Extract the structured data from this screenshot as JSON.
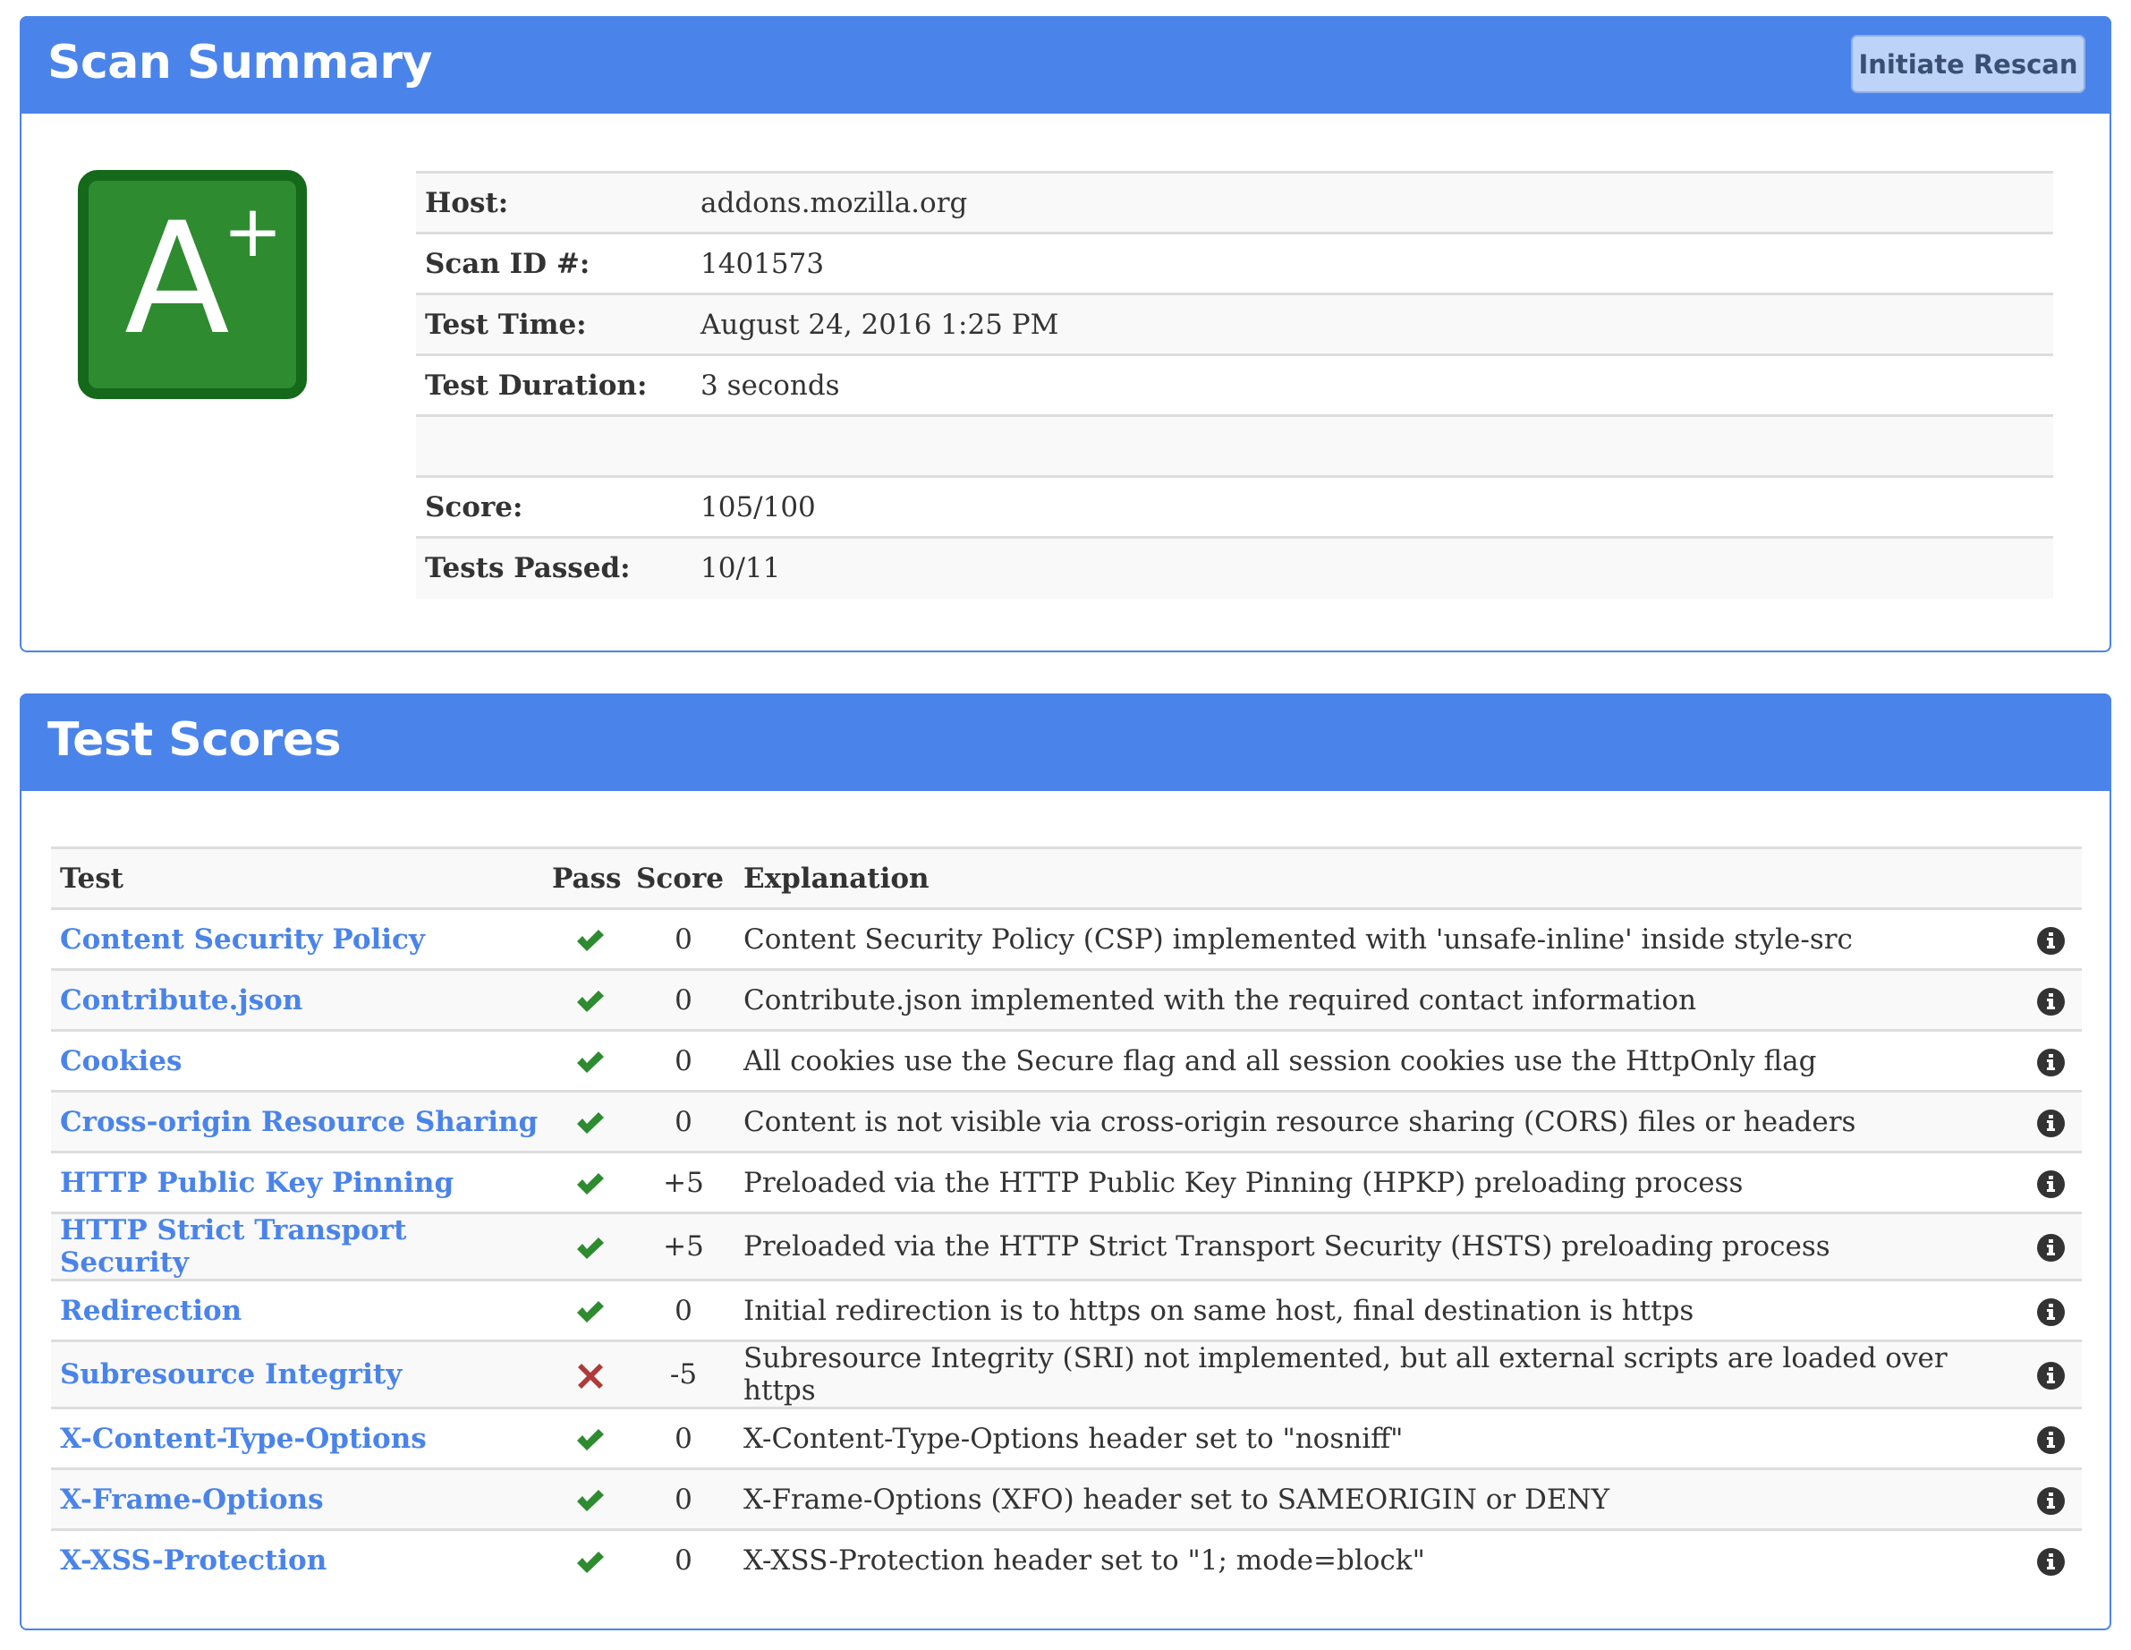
{
  "colors": {
    "accent": "#4a84ea",
    "pass": "#2e8b30",
    "fail": "#b03a3a",
    "grade_fill": "#2e8b30",
    "grade_border": "#14691a"
  },
  "summary": {
    "title": "Scan Summary",
    "rescan_button": "Initiate Rescan",
    "grade": {
      "letter": "A",
      "modifier": "+"
    },
    "rows": [
      {
        "label": "Host:",
        "value": "addons.mozilla.org"
      },
      {
        "label": "Scan ID #:",
        "value": "1401573"
      },
      {
        "label": "Test Time:",
        "value": "August 24, 2016 1:25 PM"
      },
      {
        "label": "Test Duration:",
        "value": "3 seconds"
      },
      {
        "label": "",
        "value": ""
      },
      {
        "label": "Score:",
        "value": "105/100"
      },
      {
        "label": "Tests Passed:",
        "value": "10/11"
      }
    ]
  },
  "scores": {
    "title": "Test Scores",
    "columns": {
      "test": "Test",
      "pass": "Pass",
      "score": "Score",
      "explanation": "Explanation"
    },
    "rows": [
      {
        "test": "Content Security Policy",
        "pass": true,
        "score": "0",
        "explanation": "Content Security Policy (CSP) implemented with 'unsafe-inline' inside style-src",
        "icon": "info-icon"
      },
      {
        "test": "Contribute.json",
        "pass": true,
        "score": "0",
        "explanation": "Contribute.json implemented with the required contact information",
        "icon": "info-icon"
      },
      {
        "test": "Cookies",
        "pass": true,
        "score": "0",
        "explanation": "All cookies use the Secure flag and all session cookies use the HttpOnly flag",
        "icon": "info-icon"
      },
      {
        "test": "Cross-origin Resource Sharing",
        "pass": true,
        "score": "0",
        "explanation": "Content is not visible via cross-origin resource sharing (CORS) files or headers",
        "icon": "info-icon"
      },
      {
        "test": "HTTP Public Key Pinning",
        "pass": true,
        "score": "+5",
        "explanation": "Preloaded via the HTTP Public Key Pinning (HPKP) preloading process",
        "icon": "info-icon"
      },
      {
        "test": "HTTP Strict Transport Security",
        "pass": true,
        "score": "+5",
        "explanation": "Preloaded via the HTTP Strict Transport Security (HSTS) preloading process",
        "icon": "info-icon"
      },
      {
        "test": "Redirection",
        "pass": true,
        "score": "0",
        "explanation": "Initial redirection is to https on same host, final destination is https",
        "icon": "info-icon"
      },
      {
        "test": "Subresource Integrity",
        "pass": false,
        "score": "-5",
        "explanation": "Subresource Integrity (SRI) not implemented, but all external scripts are loaded over https",
        "icon": "info-icon"
      },
      {
        "test": "X-Content-Type-Options",
        "pass": true,
        "score": "0",
        "explanation": "X-Content-Type-Options header set to \"nosniff\"",
        "icon": "info-icon"
      },
      {
        "test": "X-Frame-Options",
        "pass": true,
        "score": "0",
        "explanation": "X-Frame-Options (XFO) header set to SAMEORIGIN or DENY",
        "icon": "info-icon"
      },
      {
        "test": "X-XSS-Protection",
        "pass": true,
        "score": "0",
        "explanation": "X-XSS-Protection header set to \"1; mode=block\"",
        "icon": "info-icon"
      }
    ]
  }
}
